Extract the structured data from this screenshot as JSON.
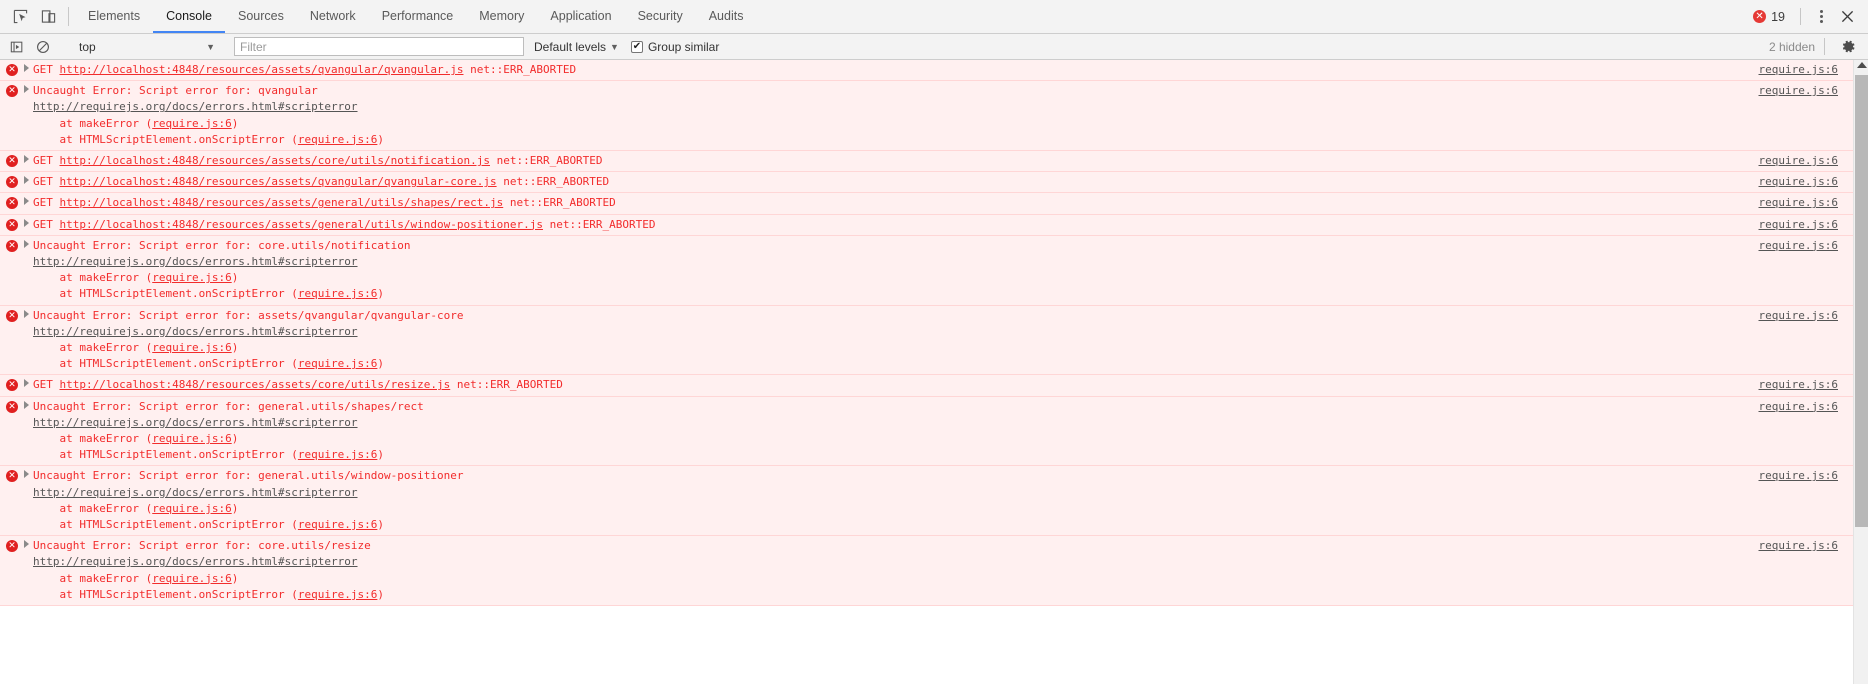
{
  "window": {
    "title": "Chrome DevTools"
  },
  "tabbar": {
    "inspect_icon": "inspect-element-icon",
    "device_icon": "device-toolbar-icon",
    "tabs": [
      {
        "label": "Elements",
        "active": false
      },
      {
        "label": "Console",
        "active": true
      },
      {
        "label": "Sources",
        "active": false
      },
      {
        "label": "Network",
        "active": false
      },
      {
        "label": "Performance",
        "active": false
      },
      {
        "label": "Memory",
        "active": false
      },
      {
        "label": "Application",
        "active": false
      },
      {
        "label": "Security",
        "active": false
      },
      {
        "label": "Audits",
        "active": false
      }
    ],
    "error_count": "19",
    "error_badge_glyph": "✕",
    "more_icon": "kebab-menu-icon",
    "close_icon": "close-icon",
    "close_glyph": "✕"
  },
  "filterbar": {
    "execute_icon": "execute-sidebar-icon",
    "clear_icon": "clear-console-icon",
    "context": "top",
    "context_caret": "▼",
    "filter_value": "",
    "filter_placeholder": "Filter",
    "levels_label": "Default levels",
    "levels_caret": "▼",
    "group_similar_label": "Group similar",
    "group_similar_checked": true,
    "group_similar_glyph": "✔",
    "hidden_count": "2 hidden",
    "settings_icon": "gear-icon"
  },
  "console": {
    "source_link": "require.js:6",
    "messages": [
      {
        "id": "msg-1",
        "level": "error",
        "source": "require.js:6",
        "lines": [
          [
            {
              "t": "GET ",
              "s": "red"
            },
            {
              "t": "http://localhost:4848/resources/assets/qvangular/qvangular.js",
              "s": "redlink"
            },
            {
              "t": " net::ERR_ABORTED",
              "s": "red"
            }
          ]
        ]
      },
      {
        "id": "msg-2",
        "level": "error",
        "source": "require.js:6",
        "lines": [
          [
            {
              "t": "Uncaught Error: Script error for: qvangular",
              "s": "red"
            }
          ],
          [
            {
              "t": "http://requirejs.org/docs/errors.html#scripterror",
              "s": "darklink"
            }
          ],
          [
            {
              "t": "    at makeError (",
              "s": "red"
            },
            {
              "t": "require.js:6",
              "s": "redlink"
            },
            {
              "t": ")",
              "s": "red"
            }
          ],
          [
            {
              "t": "    at HTMLScriptElement.onScriptError (",
              "s": "red"
            },
            {
              "t": "require.js:6",
              "s": "redlink"
            },
            {
              "t": ")",
              "s": "red"
            }
          ]
        ]
      },
      {
        "id": "msg-3",
        "level": "error",
        "source": "require.js:6",
        "lines": [
          [
            {
              "t": "GET ",
              "s": "red"
            },
            {
              "t": "http://localhost:4848/resources/assets/core/utils/notification.js",
              "s": "redlink"
            },
            {
              "t": " net::ERR_ABORTED",
              "s": "red"
            }
          ]
        ]
      },
      {
        "id": "msg-4",
        "level": "error",
        "source": "require.js:6",
        "lines": [
          [
            {
              "t": "GET ",
              "s": "red"
            },
            {
              "t": "http://localhost:4848/resources/assets/qvangular/qvangular-core.js",
              "s": "redlink"
            },
            {
              "t": " net::ERR_ABORTED",
              "s": "red"
            }
          ]
        ]
      },
      {
        "id": "msg-5",
        "level": "error",
        "source": "require.js:6",
        "lines": [
          [
            {
              "t": "GET ",
              "s": "red"
            },
            {
              "t": "http://localhost:4848/resources/assets/general/utils/shapes/rect.js",
              "s": "redlink"
            },
            {
              "t": " net::ERR_ABORTED",
              "s": "red"
            }
          ]
        ]
      },
      {
        "id": "msg-6",
        "level": "error",
        "source": "require.js:6",
        "lines": [
          [
            {
              "t": "GET ",
              "s": "red"
            },
            {
              "t": "http://localhost:4848/resources/assets/general/utils/window-positioner.js",
              "s": "redlink"
            },
            {
              "t": " net::ERR_ABORTED",
              "s": "red"
            }
          ]
        ]
      },
      {
        "id": "msg-7",
        "level": "error",
        "source": "require.js:6",
        "lines": [
          [
            {
              "t": "Uncaught Error: Script error for: core.utils/notification",
              "s": "red"
            }
          ],
          [
            {
              "t": "http://requirejs.org/docs/errors.html#scripterror",
              "s": "darklink"
            }
          ],
          [
            {
              "t": "    at makeError (",
              "s": "red"
            },
            {
              "t": "require.js:6",
              "s": "redlink"
            },
            {
              "t": ")",
              "s": "red"
            }
          ],
          [
            {
              "t": "    at HTMLScriptElement.onScriptError (",
              "s": "red"
            },
            {
              "t": "require.js:6",
              "s": "redlink"
            },
            {
              "t": ")",
              "s": "red"
            }
          ]
        ]
      },
      {
        "id": "msg-8",
        "level": "error",
        "source": "require.js:6",
        "lines": [
          [
            {
              "t": "Uncaught Error: Script error for: assets/qvangular/qvangular-core",
              "s": "red"
            }
          ],
          [
            {
              "t": "http://requirejs.org/docs/errors.html#scripterror",
              "s": "darklink"
            }
          ],
          [
            {
              "t": "    at makeError (",
              "s": "red"
            },
            {
              "t": "require.js:6",
              "s": "redlink"
            },
            {
              "t": ")",
              "s": "red"
            }
          ],
          [
            {
              "t": "    at HTMLScriptElement.onScriptError (",
              "s": "red"
            },
            {
              "t": "require.js:6",
              "s": "redlink"
            },
            {
              "t": ")",
              "s": "red"
            }
          ]
        ]
      },
      {
        "id": "msg-9",
        "level": "error",
        "source": "require.js:6",
        "lines": [
          [
            {
              "t": "GET ",
              "s": "red"
            },
            {
              "t": "http://localhost:4848/resources/assets/core/utils/resize.js",
              "s": "redlink"
            },
            {
              "t": " net::ERR_ABORTED",
              "s": "red"
            }
          ]
        ]
      },
      {
        "id": "msg-10",
        "level": "error",
        "source": "require.js:6",
        "lines": [
          [
            {
              "t": "Uncaught Error: Script error for: general.utils/shapes/rect",
              "s": "red"
            }
          ],
          [
            {
              "t": "http://requirejs.org/docs/errors.html#scripterror",
              "s": "darklink"
            }
          ],
          [
            {
              "t": "    at makeError (",
              "s": "red"
            },
            {
              "t": "require.js:6",
              "s": "redlink"
            },
            {
              "t": ")",
              "s": "red"
            }
          ],
          [
            {
              "t": "    at HTMLScriptElement.onScriptError (",
              "s": "red"
            },
            {
              "t": "require.js:6",
              "s": "redlink"
            },
            {
              "t": ")",
              "s": "red"
            }
          ]
        ]
      },
      {
        "id": "msg-11",
        "level": "error",
        "source": "require.js:6",
        "lines": [
          [
            {
              "t": "Uncaught Error: Script error for: general.utils/window-positioner",
              "s": "red"
            }
          ],
          [
            {
              "t": "http://requirejs.org/docs/errors.html#scripterror",
              "s": "darklink"
            }
          ],
          [
            {
              "t": "    at makeError (",
              "s": "red"
            },
            {
              "t": "require.js:6",
              "s": "redlink"
            },
            {
              "t": ")",
              "s": "red"
            }
          ],
          [
            {
              "t": "    at HTMLScriptElement.onScriptError (",
              "s": "red"
            },
            {
              "t": "require.js:6",
              "s": "redlink"
            },
            {
              "t": ")",
              "s": "red"
            }
          ]
        ]
      },
      {
        "id": "msg-12",
        "level": "error",
        "source": "require.js:6",
        "lines": [
          [
            {
              "t": "Uncaught Error: Script error for: core.utils/resize",
              "s": "red"
            }
          ],
          [
            {
              "t": "http://requirejs.org/docs/errors.html#scripterror",
              "s": "darklink"
            }
          ],
          [
            {
              "t": "    at makeError (",
              "s": "red"
            },
            {
              "t": "require.js:6",
              "s": "redlink"
            },
            {
              "t": ")",
              "s": "red"
            }
          ],
          [
            {
              "t": "    at HTMLScriptElement.onScriptError (",
              "s": "red"
            },
            {
              "t": "require.js:6",
              "s": "redlink"
            },
            {
              "t": ")",
              "s": "red"
            }
          ]
        ]
      }
    ]
  },
  "colors": {
    "error_red": "#f22c2c",
    "error_bg": "#fff0f0",
    "error_border": "#ffd6d6",
    "accent_blue": "#4285f4",
    "toolbar_bg": "#f3f3f3"
  }
}
